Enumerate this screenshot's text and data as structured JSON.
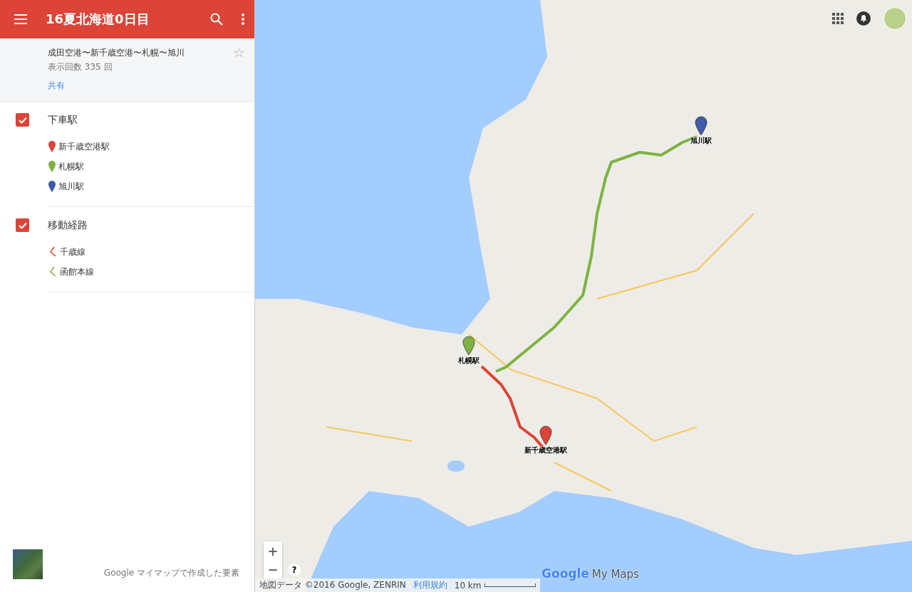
{
  "header": {
    "title": "16夏北海道0日目"
  },
  "map_info": {
    "description": "成田空港〜新千歳空港〜札幌〜旭川",
    "views": "表示回数 335 回",
    "share": "共有",
    "starred": false
  },
  "layers": [
    {
      "name": "下車駅",
      "checked": true,
      "items": [
        {
          "kind": "marker",
          "label": "新千歳空港駅",
          "color": "#db4437"
        },
        {
          "kind": "marker",
          "label": "札幌駅",
          "color": "#7cb342"
        },
        {
          "kind": "marker",
          "label": "旭川駅",
          "color": "#3f5ba9"
        }
      ]
    },
    {
      "name": "移動経路",
      "checked": true,
      "items": [
        {
          "kind": "line",
          "label": "千歳線",
          "color": "#db4437"
        },
        {
          "kind": "line",
          "label": "函館本線",
          "color": "#7cb342"
        }
      ]
    }
  ],
  "footer": {
    "text": "Google マイマップで作成した要素"
  },
  "map": {
    "markers": [
      {
        "label": "札幌駅",
        "color": "#7cb342"
      },
      {
        "label": "新千歳空港駅",
        "color": "#db4437"
      },
      {
        "label": "旭川駅",
        "color": "#3f5ba9"
      }
    ],
    "routes": [
      {
        "color": "#db4437"
      },
      {
        "color": "#7cb342"
      }
    ],
    "zoom_in": "+",
    "zoom_out": "−",
    "help": "?",
    "logo_brand": "Google",
    "logo_product": "My Maps",
    "attribution": "地図データ ©2016 Google, ZENRIN",
    "terms": "利用規約",
    "scale": "10 km"
  }
}
